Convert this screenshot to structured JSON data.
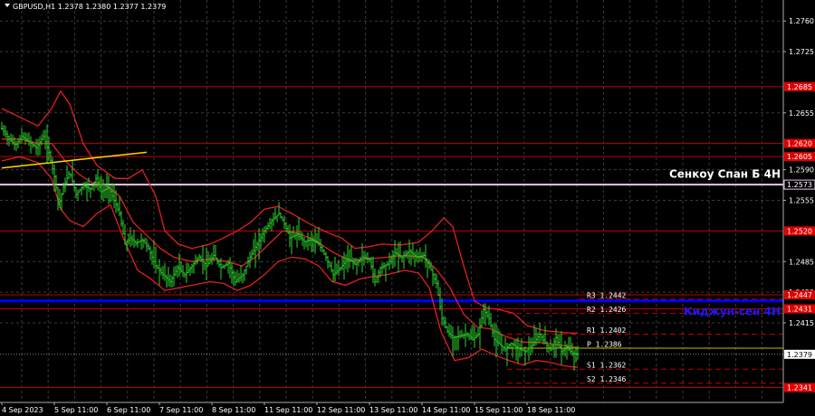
{
  "header": {
    "symbol_line": "GBPUSD,H1  1.2378 1.2380 1.2377 1.2379"
  },
  "chart_data": {
    "type": "candlestick",
    "symbol": "GBPUSD",
    "timeframe": "H1",
    "ohlc_last": {
      "open": 1.2378,
      "high": 1.238,
      "low": 1.2377,
      "close": 1.2379
    },
    "current_price": 1.2379,
    "current_price_label": "1.2379",
    "ylim": [
      1.2324,
      1.2784
    ],
    "y_ticks": [
      1.276,
      1.2725,
      1.2655,
      1.259,
      1.2555,
      1.2485,
      1.245,
      1.2415
    ],
    "y_tick_labels": [
      "1.2760",
      "1.2725",
      "1.2655",
      "1.2590",
      "1.2555",
      "1.2485",
      "1.2450",
      "1.2415"
    ],
    "x_ticks": [
      "4 Sep 2023",
      "5 Sep 11:00",
      "6 Sep 11:00",
      "7 Sep 11:00",
      "8 Sep 11:00",
      "11 Sep 11:00",
      "12 Sep 11:00",
      "13 Sep 11:00",
      "14 Sep 11:00",
      "15 Sep 11:00",
      "18 Sep 11:00"
    ],
    "price_series": [
      [
        0,
        1.2637
      ],
      [
        8,
        1.2625
      ],
      [
        15,
        1.2618
      ],
      [
        22,
        1.2628
      ],
      [
        30,
        1.2622
      ],
      [
        38,
        1.2615
      ],
      [
        46,
        1.2628
      ],
      [
        52,
        1.261
      ],
      [
        58,
        1.2582
      ],
      [
        63,
        1.255
      ],
      [
        68,
        1.257
      ],
      [
        75,
        1.2588
      ],
      [
        82,
        1.2562
      ],
      [
        90,
        1.2572
      ],
      [
        98,
        1.2568
      ],
      [
        104,
        1.258
      ],
      [
        110,
        1.2565
      ],
      [
        118,
        1.257
      ],
      [
        124,
        1.2555
      ],
      [
        130,
        1.254
      ],
      [
        136,
        1.2505
      ],
      [
        142,
        1.2512
      ],
      [
        148,
        1.2506
      ],
      [
        155,
        1.251
      ],
      [
        162,
        1.25
      ],
      [
        170,
        1.248
      ],
      [
        178,
        1.247
      ],
      [
        186,
        1.2462
      ],
      [
        194,
        1.2478
      ],
      [
        202,
        1.247
      ],
      [
        210,
        1.248
      ],
      [
        218,
        1.249
      ],
      [
        226,
        1.248
      ],
      [
        234,
        1.2492
      ],
      [
        242,
        1.2478
      ],
      [
        250,
        1.2483
      ],
      [
        258,
        1.2462
      ],
      [
        266,
        1.247
      ],
      [
        274,
        1.249
      ],
      [
        282,
        1.2505
      ],
      [
        290,
        1.252
      ],
      [
        298,
        1.2532
      ],
      [
        306,
        1.254
      ],
      [
        312,
        1.2528
      ],
      [
        318,
        1.2512
      ],
      [
        326,
        1.2516
      ],
      [
        334,
        1.2508
      ],
      [
        342,
        1.251
      ],
      [
        350,
        1.2505
      ],
      [
        358,
        1.249
      ],
      [
        366,
        1.247
      ],
      [
        374,
        1.2478
      ],
      [
        382,
        1.2488
      ],
      [
        390,
        1.2482
      ],
      [
        398,
        1.249
      ],
      [
        406,
        1.2488
      ],
      [
        412,
        1.2462
      ],
      [
        418,
        1.2478
      ],
      [
        426,
        1.2482
      ],
      [
        434,
        1.2495
      ],
      [
        442,
        1.249
      ],
      [
        450,
        1.2497
      ],
      [
        458,
        1.249
      ],
      [
        466,
        1.2492
      ],
      [
        474,
        1.2475
      ],
      [
        480,
        1.246
      ],
      [
        486,
        1.242
      ],
      [
        492,
        1.2405
      ],
      [
        498,
        1.2398
      ],
      [
        506,
        1.24
      ],
      [
        514,
        1.2402
      ],
      [
        520,
        1.2396
      ],
      [
        526,
        1.2402
      ],
      [
        532,
        1.243
      ],
      [
        538,
        1.242
      ],
      [
        544,
        1.2396
      ],
      [
        550,
        1.239
      ],
      [
        556,
        1.2385
      ],
      [
        562,
        1.2392
      ],
      [
        570,
        1.2386
      ],
      [
        578,
        1.2382
      ],
      [
        586,
        1.239
      ],
      [
        594,
        1.2402
      ],
      [
        600,
        1.2392
      ],
      [
        606,
        1.2384
      ],
      [
        612,
        1.2398
      ],
      [
        618,
        1.2382
      ],
      [
        624,
        1.2387
      ],
      [
        630,
        1.238
      ],
      [
        636,
        1.2379
      ]
    ],
    "bollinger": {
      "upper": [
        [
          0,
          1.266
        ],
        [
          20,
          1.265
        ],
        [
          40,
          1.264
        ],
        [
          55,
          1.266
        ],
        [
          65,
          1.268
        ],
        [
          75,
          1.2665
        ],
        [
          90,
          1.262
        ],
        [
          105,
          1.2595
        ],
        [
          125,
          1.258
        ],
        [
          140,
          1.258
        ],
        [
          155,
          1.259
        ],
        [
          170,
          1.256
        ],
        [
          180,
          1.252
        ],
        [
          195,
          1.2505
        ],
        [
          210,
          1.25
        ],
        [
          230,
          1.2505
        ],
        [
          245,
          1.2512
        ],
        [
          260,
          1.252
        ],
        [
          275,
          1.253
        ],
        [
          290,
          1.2545
        ],
        [
          305,
          1.2548
        ],
        [
          320,
          1.254
        ],
        [
          340,
          1.2528
        ],
        [
          360,
          1.2518
        ],
        [
          375,
          1.2512
        ],
        [
          390,
          1.25
        ],
        [
          405,
          1.2502
        ],
        [
          420,
          1.2505
        ],
        [
          440,
          1.2504
        ],
        [
          460,
          1.2507
        ],
        [
          475,
          1.252
        ],
        [
          488,
          1.2535
        ],
        [
          498,
          1.2525
        ],
        [
          510,
          1.248
        ],
        [
          522,
          1.244
        ],
        [
          535,
          1.2432
        ],
        [
          550,
          1.243
        ],
        [
          565,
          1.2426
        ],
        [
          580,
          1.2412
        ],
        [
          600,
          1.2406
        ],
        [
          620,
          1.2404
        ],
        [
          636,
          1.2403
        ]
      ],
      "middle": [
        [
          0,
          1.2625
        ],
        [
          20,
          1.2625
        ],
        [
          40,
          1.262
        ],
        [
          55,
          1.262
        ],
        [
          70,
          1.26
        ],
        [
          85,
          1.2585
        ],
        [
          100,
          1.2575
        ],
        [
          115,
          1.2572
        ],
        [
          130,
          1.256
        ],
        [
          145,
          1.253
        ],
        [
          160,
          1.2515
        ],
        [
          175,
          1.25
        ],
        [
          190,
          1.249
        ],
        [
          210,
          1.2485
        ],
        [
          230,
          1.2488
        ],
        [
          250,
          1.2485
        ],
        [
          265,
          1.248
        ],
        [
          280,
          1.249
        ],
        [
          295,
          1.2505
        ],
        [
          310,
          1.252
        ],
        [
          325,
          1.2518
        ],
        [
          345,
          1.251
        ],
        [
          365,
          1.2496
        ],
        [
          385,
          1.2486
        ],
        [
          405,
          1.2488
        ],
        [
          425,
          1.249
        ],
        [
          445,
          1.2492
        ],
        [
          465,
          1.249
        ],
        [
          480,
          1.2476
        ],
        [
          495,
          1.2455
        ],
        [
          510,
          1.2425
        ],
        [
          525,
          1.241
        ],
        [
          540,
          1.2408
        ],
        [
          555,
          1.24
        ],
        [
          575,
          1.2393
        ],
        [
          600,
          1.2392
        ],
        [
          620,
          1.2389
        ],
        [
          636,
          1.2387
        ]
      ],
      "lower": [
        [
          0,
          1.26
        ],
        [
          20,
          1.2605
        ],
        [
          40,
          1.2598
        ],
        [
          55,
          1.258
        ],
        [
          65,
          1.2545
        ],
        [
          75,
          1.2532
        ],
        [
          90,
          1.2525
        ],
        [
          105,
          1.254
        ],
        [
          120,
          1.255
        ],
        [
          135,
          1.251
        ],
        [
          150,
          1.2475
        ],
        [
          165,
          1.2465
        ],
        [
          180,
          1.2452
        ],
        [
          195,
          1.2455
        ],
        [
          210,
          1.2458
        ],
        [
          230,
          1.2462
        ],
        [
          245,
          1.246
        ],
        [
          260,
          1.2452
        ],
        [
          275,
          1.2458
        ],
        [
          290,
          1.247
        ],
        [
          305,
          1.2485
        ],
        [
          320,
          1.249
        ],
        [
          335,
          1.2488
        ],
        [
          350,
          1.248
        ],
        [
          365,
          1.2462
        ],
        [
          380,
          1.2458
        ],
        [
          395,
          1.2465
        ],
        [
          410,
          1.2468
        ],
        [
          425,
          1.247
        ],
        [
          445,
          1.2475
        ],
        [
          460,
          1.2472
        ],
        [
          472,
          1.2455
        ],
        [
          485,
          1.2405
        ],
        [
          500,
          1.2372
        ],
        [
          515,
          1.2375
        ],
        [
          530,
          1.2385
        ],
        [
          545,
          1.2378
        ],
        [
          560,
          1.2372
        ],
        [
          575,
          1.2367
        ],
        [
          590,
          1.2372
        ],
        [
          605,
          1.237
        ],
        [
          620,
          1.2366
        ],
        [
          636,
          1.2364
        ]
      ]
    },
    "trend_line": {
      "from": [
        0,
        1.2592
      ],
      "to": [
        160,
        1.261
      ],
      "color": "#FFD700"
    },
    "horizontal_levels": [
      {
        "value": 1.2685,
        "label": "1.2685",
        "color": "#C00000",
        "style": "solid"
      },
      {
        "value": 1.262,
        "label": "1.2620",
        "color": "#C00000",
        "style": "solid"
      },
      {
        "value": 1.2605,
        "label": "1.2605",
        "color": "#C00000",
        "style": "solid"
      },
      {
        "value": 1.2573,
        "label": "1.2573",
        "color": "#E6C8E6",
        "style": "solid"
      },
      {
        "value": 1.252,
        "label": "1.2520",
        "color": "#C00000",
        "style": "solid"
      },
      {
        "value": 1.2447,
        "label": "1.2447",
        "color": "#C00000",
        "style": "solid"
      },
      {
        "value": 1.2431,
        "label": "1.2431",
        "color": "#C00000",
        "style": "solid"
      },
      {
        "value": 1.2341,
        "label": "1.2341",
        "color": "#C00000",
        "style": "solid"
      }
    ],
    "kijun": {
      "value": 1.244,
      "color": "#0000FF"
    },
    "pivots": [
      {
        "name": "R3",
        "value": 1.2442,
        "label": "R3  1.2442"
      },
      {
        "name": "R2",
        "value": 1.2426,
        "label": "R2  1.2426"
      },
      {
        "name": "R1",
        "value": 1.2402,
        "label": "R1  1.2402"
      },
      {
        "name": "P",
        "value": 1.2386,
        "label": "P  1.2386"
      },
      {
        "name": "S1",
        "value": 1.2362,
        "label": "S1  1.2362"
      },
      {
        "name": "S2",
        "value": 1.2346,
        "label": "S2  1.2346"
      }
    ],
    "annotations": [
      {
        "text": "Сенкоу Спан Б 4Н",
        "value": 1.2585,
        "color": "#FFFFFF"
      },
      {
        "text": "Киджун-сен 4Н",
        "value": 1.2428,
        "color": "#1A1AFF"
      }
    ]
  }
}
